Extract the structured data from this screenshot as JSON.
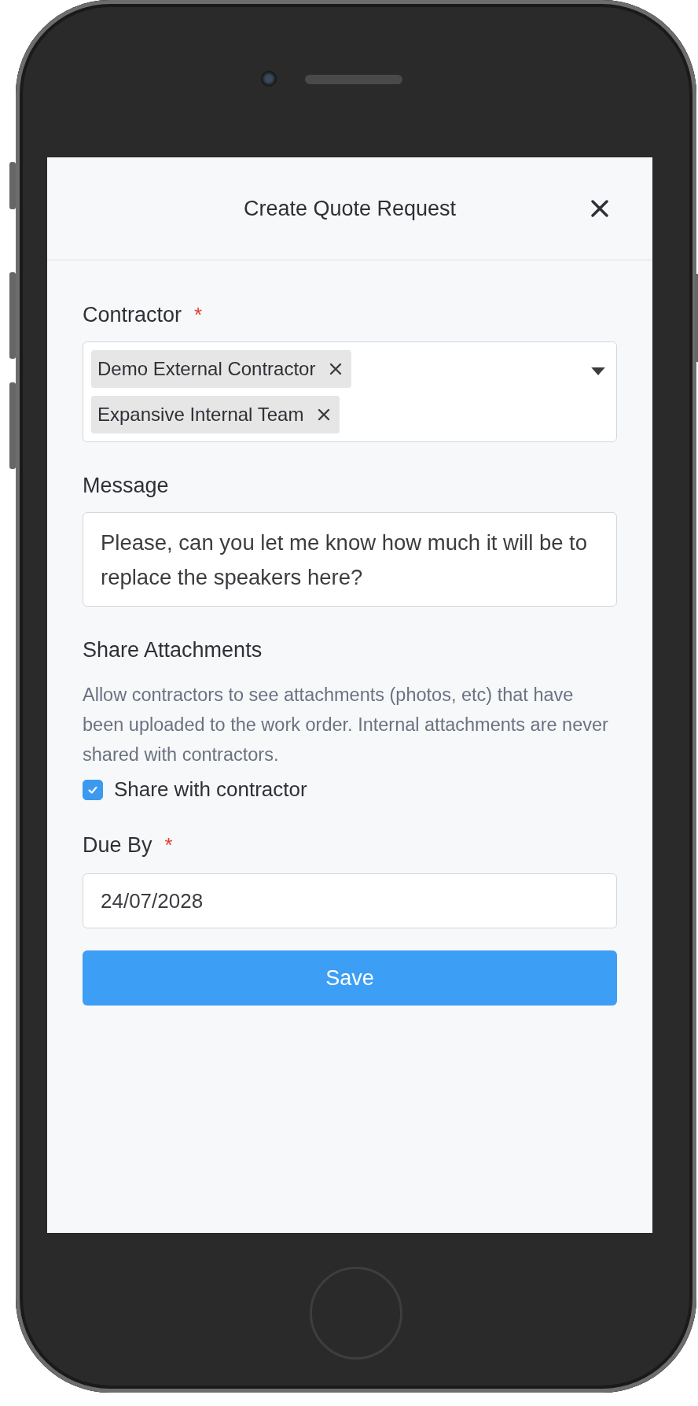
{
  "header": {
    "title": "Create Quote Request"
  },
  "contractor": {
    "label": "Contractor",
    "required_mark": "*",
    "tags": [
      {
        "label": "Demo External Contractor"
      },
      {
        "label": "Expansive Internal Team"
      }
    ]
  },
  "message": {
    "label": "Message",
    "value": "Please, can you let me know how much it will be to replace the speakers here?"
  },
  "share_attachments": {
    "heading": "Share Attachments",
    "help": "Allow contractors to see attachments (photos, etc) that have been uploaded to the work order. Internal attachments are never shared with contractors.",
    "checkbox": {
      "label": "Share with contractor",
      "checked": true
    }
  },
  "due_by": {
    "label": "Due By",
    "required_mark": "*",
    "value": "24/07/2028"
  },
  "save_button": "Save"
}
